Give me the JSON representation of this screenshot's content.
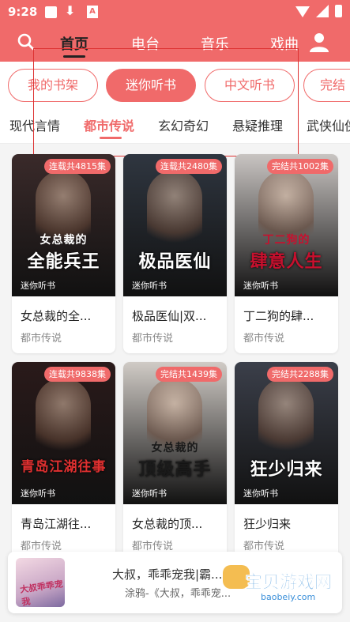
{
  "status": {
    "time": "9:28",
    "notif_icon_letter": "A"
  },
  "topnav": {
    "tabs": [
      "首页",
      "电台",
      "音乐",
      "戏曲"
    ],
    "active_tab": "首页"
  },
  "pills": [
    "我的书架",
    "迷你听书",
    "中文听书",
    "完结"
  ],
  "active_pill": "迷你听书",
  "categories": [
    "现代言情",
    "都市传说",
    "玄幻奇幻",
    "悬疑推理",
    "武侠仙侠"
  ],
  "active_category": "都市传说",
  "books": [
    {
      "badge": "连载共4815集",
      "cover_title": "全能兵王",
      "cover_sub": "女总裁的",
      "brand": "迷你听书",
      "title": "女总裁的全...",
      "genre": "都市传说",
      "cover_bg": "#3a2a2a",
      "accent": "#ffffff"
    },
    {
      "badge": "连载共2480集",
      "cover_title": "极品医仙",
      "cover_sub": "",
      "brand": "迷你听书",
      "title": "极品医仙|双...",
      "genre": "都市传说",
      "cover_bg": "#2f3640",
      "accent": "#ffffff"
    },
    {
      "badge": "完结共1002集",
      "cover_title": "肆意人生",
      "cover_sub": "丁二狗的",
      "brand": "迷你听书",
      "title": "丁二狗的肆...",
      "genre": "都市传说",
      "cover_bg": "#c9c5c2",
      "accent": "#c8102e"
    },
    {
      "badge": "连载共9838集",
      "cover_title": "青岛江湖往事",
      "cover_sub": "",
      "brand": "迷你听书",
      "title": "青岛江湖往...",
      "genre": "都市传说",
      "cover_bg": "#2a1a1a",
      "accent": "#e03030"
    },
    {
      "badge": "完结共1439集",
      "cover_title": "顶级高手",
      "cover_sub": "女总裁的",
      "brand": "迷你听书",
      "title": "女总裁的顶...",
      "genre": "都市传说",
      "cover_bg": "#d0cbc6",
      "accent": "#1a1a1a"
    },
    {
      "badge": "完结共2288集",
      "cover_title": "狂少归来",
      "cover_sub": "",
      "brand": "迷你听书",
      "title": "狂少归来",
      "genre": "都市传说",
      "cover_bg": "#3b3f4a",
      "accent": "#ffffff"
    }
  ],
  "player": {
    "title": "大叔，乖乖宠我|霸...",
    "subtitle": "涂鸦-《大叔，乖乖宠...",
    "thumb_text": "大叔乖乖宠我"
  },
  "watermark": {
    "name": "宝贝游戏网",
    "url": "baobeiy.com"
  },
  "colors": {
    "brand": "#f06a6a"
  }
}
